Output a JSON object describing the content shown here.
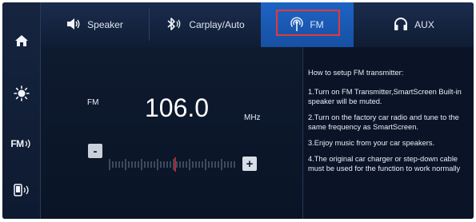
{
  "tabs": [
    {
      "label": "Speaker",
      "icon": "speaker-icon"
    },
    {
      "label": "Carplay/Auto",
      "icon": "bluetooth-icon"
    },
    {
      "label": "FM",
      "icon": "radio-broadcast-icon",
      "active": true
    },
    {
      "label": "AUX",
      "icon": "headphones-icon"
    }
  ],
  "sidebar": {
    "items": [
      {
        "icon": "home-icon"
      },
      {
        "icon": "brightness-icon"
      },
      {
        "icon": "fm-radio-icon",
        "label": "FM"
      },
      {
        "icon": "phone-cast-icon"
      }
    ]
  },
  "radio": {
    "band": "FM",
    "frequency": "106.0",
    "unit": "MHz",
    "minus_label": "-",
    "plus_label": "+"
  },
  "info": {
    "heading": "How to setup FM transmitter:",
    "steps": [
      "1.Turn on FM Transmitter,SmartScreen Built-in speaker will be muted.",
      "2.Turn on the factory car radio and tune to the same frequency as SmartScreen.",
      "3.Enjoy music from your car speakers.",
      "4.The original car charger or step-down cable must be used for the function to work normally"
    ]
  },
  "colors": {
    "active_tab": "#1e63c4",
    "highlight_border": "#e23a3a",
    "tuner_indicator": "#d43030",
    "background": "#08101f"
  }
}
